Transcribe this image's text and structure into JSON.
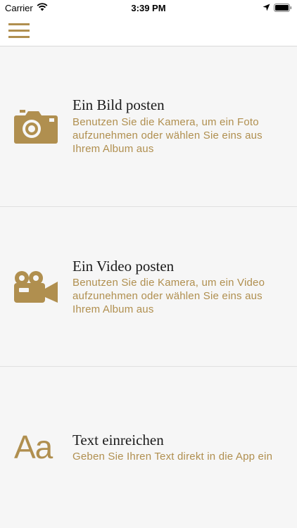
{
  "status_bar": {
    "carrier": "Carrier",
    "time": "3:39 PM",
    "icons": [
      "wifi-icon",
      "location-arrow-icon",
      "battery-icon"
    ]
  },
  "nav": {
    "menu_icon": "hamburger-menu-icon"
  },
  "accent_color": "#b08f4f",
  "options": [
    {
      "icon": "camera-icon",
      "title": "Ein Bild posten",
      "description": "Benutzen Sie die Kamera, um ein Foto aufzunehmen oder wählen Sie eins aus Ihrem Album aus"
    },
    {
      "icon": "video-camera-icon",
      "title": "Ein Video posten",
      "description": "Benutzen Sie die Kamera, um ein Video aufzunehmen oder wählen Sie eins aus Ihrem Album aus"
    },
    {
      "icon": "text-icon",
      "icon_text": "Aa",
      "title": "Text einreichen",
      "description": "Geben Sie Ihren Text direkt in die App ein"
    }
  ]
}
